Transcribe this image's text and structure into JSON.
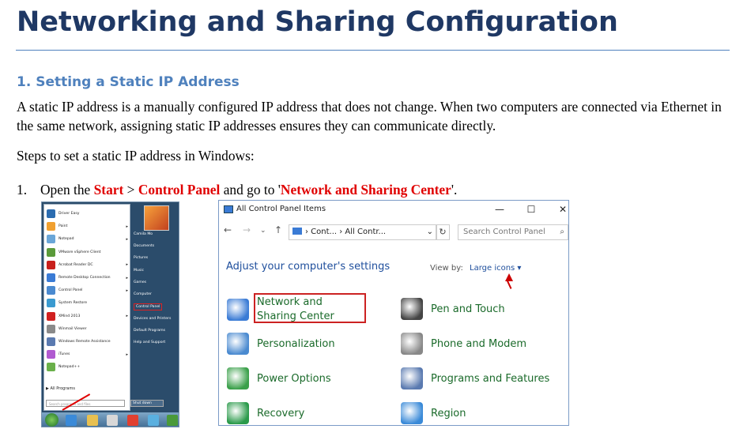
{
  "document": {
    "title": "Networking and Sharing Configuration",
    "section_heading": "1. Setting a Static IP Address",
    "paragraph": "A static IP address is a manually configured IP address that does not change. When two computers are connected via Ethernet in the same network, assigning static IP addresses ensures they can communicate directly.",
    "steps_intro": "Steps to set a static IP address in Windows:",
    "step1": {
      "number": "1.",
      "text_open": "Open the ",
      "start": "Start",
      "sep": " > ",
      "control_panel": "Control Panel",
      "text_go": " and go to '",
      "network_center": "Network and Sharing Center",
      "text_end": "'."
    }
  },
  "start_menu": {
    "left_items": [
      {
        "label": "Driver Easy",
        "color": "#2b6cb0",
        "arrow": ""
      },
      {
        "label": "Paint",
        "color": "#f0a030",
        "arrow": "▸"
      },
      {
        "label": "Notepad",
        "color": "#6aa6d8",
        "arrow": "▸"
      },
      {
        "label": "VMware vSphere Client",
        "color": "#5a9a3a",
        "arrow": ""
      },
      {
        "label": "Acrobat Reader DC",
        "color": "#c8201c",
        "arrow": "▸"
      },
      {
        "label": "Remote Desktop Connection",
        "color": "#3a7bd5",
        "arrow": "▸"
      },
      {
        "label": "Control Panel",
        "color": "#4a8ad0",
        "arrow": "▸"
      },
      {
        "label": "System Restore",
        "color": "#3a9ad0",
        "arrow": ""
      },
      {
        "label": "XMind 2013",
        "color": "#d02020",
        "arrow": "▸"
      },
      {
        "label": "Winmail Viewer",
        "color": "#8a8a8a",
        "arrow": ""
      },
      {
        "label": "Windows Remote Assistance",
        "color": "#5a7ab0",
        "arrow": ""
      },
      {
        "label": "iTunes",
        "color": "#b05ad0",
        "arrow": "▸"
      },
      {
        "label": "Notepad++",
        "color": "#6ab04a",
        "arrow": ""
      }
    ],
    "all_programs": "All Programs",
    "search_placeholder": "Search programs and files",
    "user": "Camila Mo",
    "right_items": [
      "Documents",
      "Pictures",
      "Music",
      "Games",
      "Computer",
      "Control Panel",
      "Devices and Printers",
      "Default Programs",
      "Help and Support"
    ],
    "shutdown": "Shut down"
  },
  "control_panel": {
    "window_title": "All Control Panel Items",
    "minimize": "—",
    "maximize": "☐",
    "close": "✕",
    "address_parts": "› Cont... › All Contr...",
    "address_dropdown": "⌄",
    "refresh": "↻",
    "search_placeholder": "Search Control Panel",
    "heading": "Adjust your computer's settings",
    "view_by_label": "View by:",
    "view_by_value": "Large icons ▾",
    "items": [
      {
        "label": "Network and Sharing Center",
        "icon": "network-icon"
      },
      {
        "label": "Pen and Touch",
        "icon": "pen-icon"
      },
      {
        "label": "Personalization",
        "icon": "personalization-icon"
      },
      {
        "label": "Phone and Modem",
        "icon": "phone-icon"
      },
      {
        "label": "Power Options",
        "icon": "power-icon"
      },
      {
        "label": "Programs and Features",
        "icon": "programs-icon"
      },
      {
        "label": "Recovery",
        "icon": "recovery-icon"
      },
      {
        "label": "Region",
        "icon": "region-icon"
      }
    ]
  }
}
